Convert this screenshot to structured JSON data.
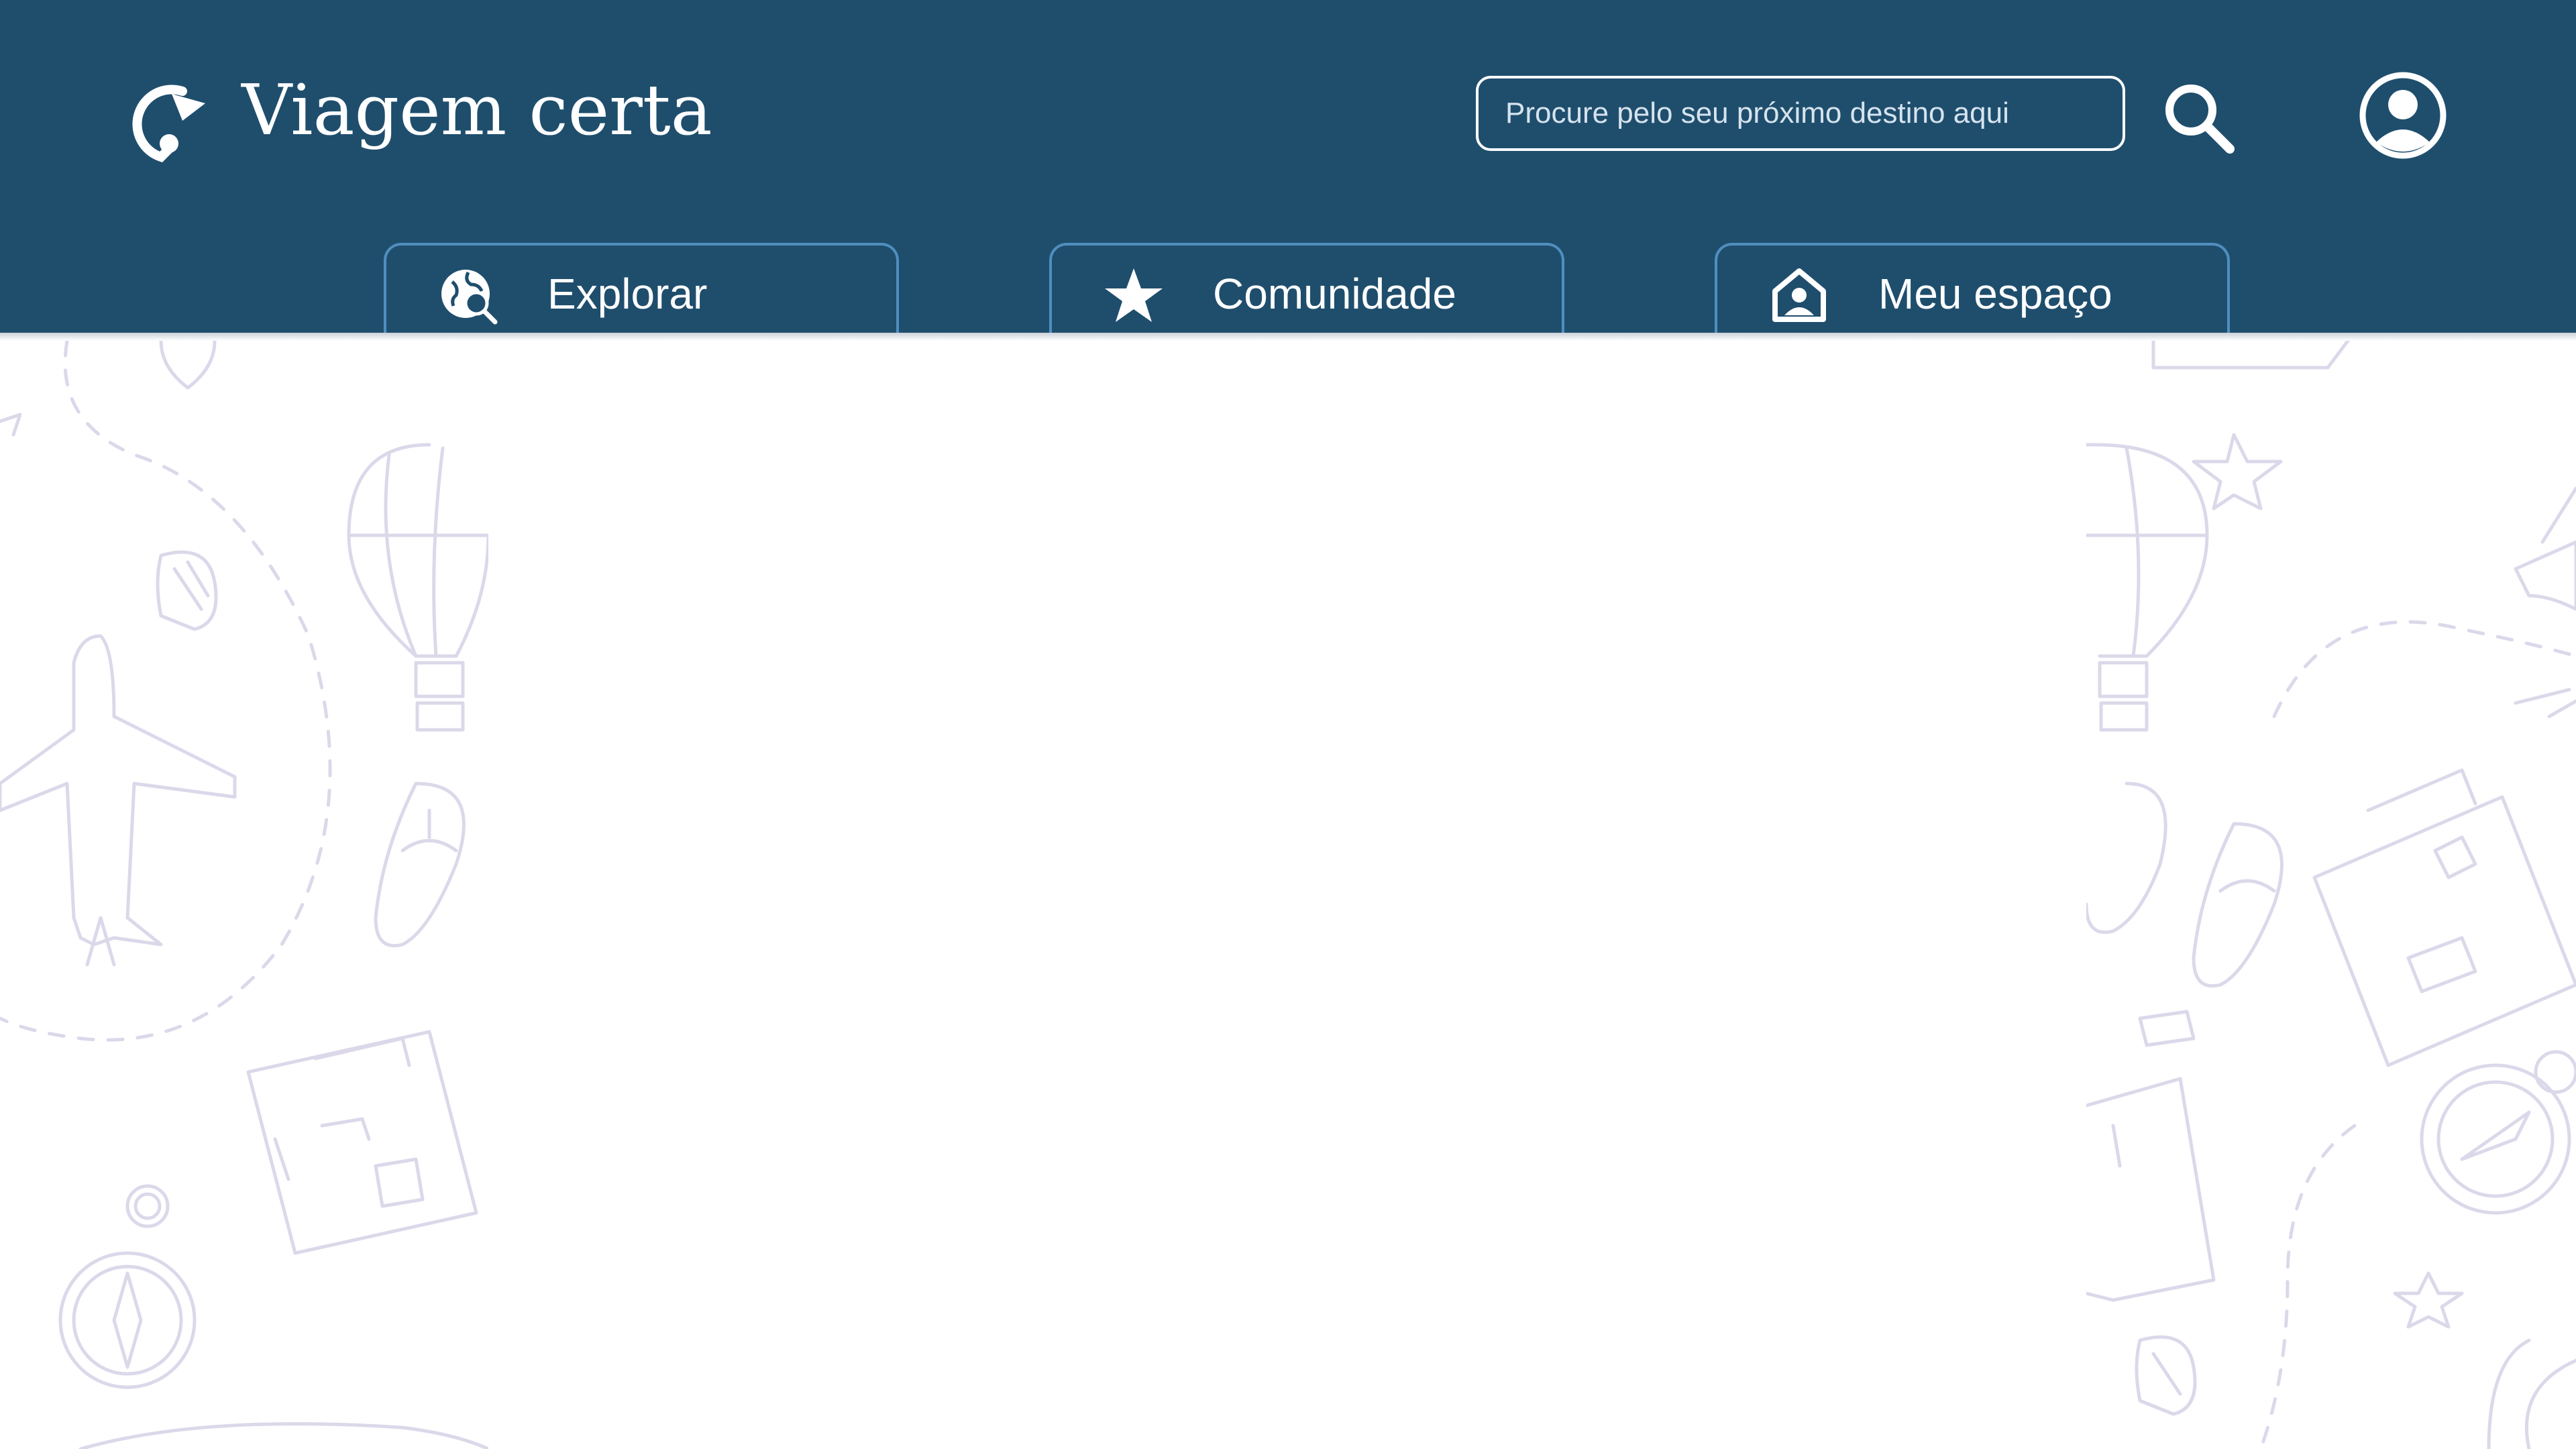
{
  "app": {
    "title": "Viagem certa"
  },
  "search": {
    "placeholder": "Procure pelo seu próximo destino aqui"
  },
  "nav": {
    "tabs": [
      {
        "label": "Explorar",
        "icon": "globe-search-icon"
      },
      {
        "label": "Comunidade",
        "icon": "star-icon"
      },
      {
        "label": "Meu espaço",
        "icon": "home-user-icon"
      }
    ]
  },
  "icons": {
    "logo": "location-refresh-icon",
    "search": "search-icon",
    "profile": "account-circle-icon"
  },
  "colors": {
    "header": "#1f4e6d",
    "tab_border": "#4f8fbf",
    "pattern_line": "#dcd8ea",
    "text": "#ffffff"
  }
}
